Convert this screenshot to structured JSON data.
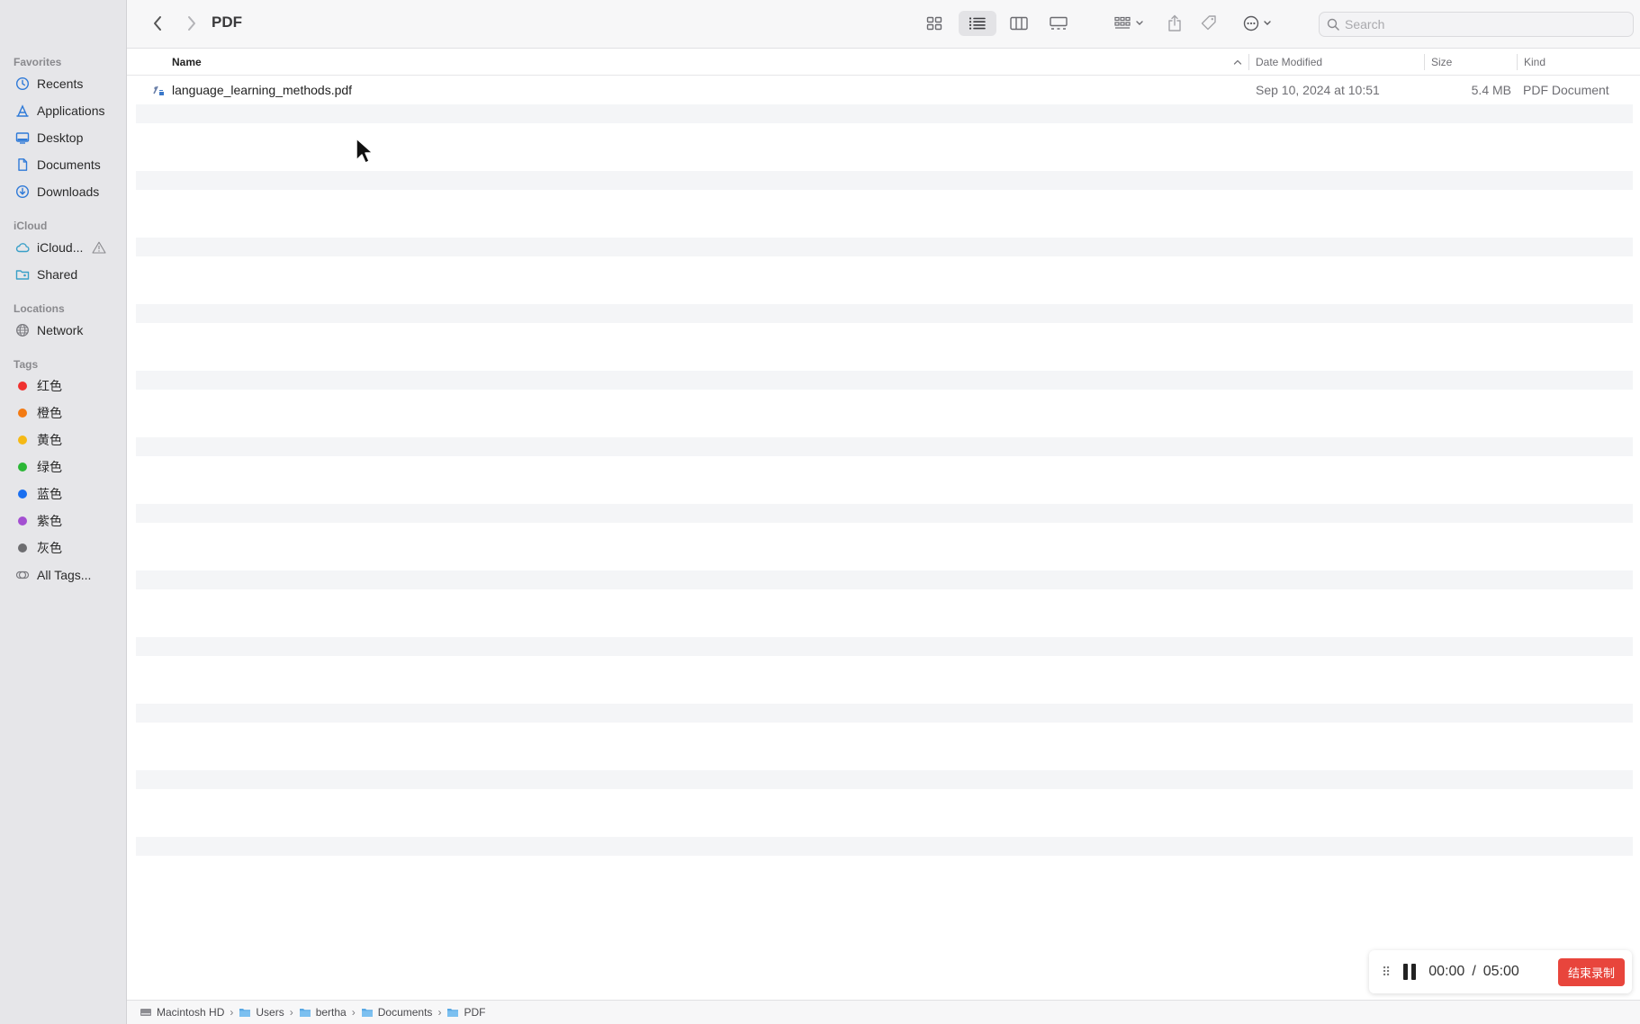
{
  "window": {
    "title": "PDF"
  },
  "toolbar": {
    "search_placeholder": "Search",
    "accent": "#2f7ad8"
  },
  "sidebar": {
    "favorites_label": "Favorites",
    "favorites": [
      {
        "label": "Recents",
        "icon": "clock-icon"
      },
      {
        "label": "Applications",
        "icon": "applications-icon"
      },
      {
        "label": "Desktop",
        "icon": "desktop-icon"
      },
      {
        "label": "Documents",
        "icon": "document-icon"
      },
      {
        "label": "Downloads",
        "icon": "download-icon"
      }
    ],
    "icloud_label": "iCloud",
    "icloud": [
      {
        "label": "iCloud...",
        "icon": "cloud-icon"
      },
      {
        "label": "Shared",
        "icon": "shared-folder-icon"
      }
    ],
    "locations_label": "Locations",
    "locations": [
      {
        "label": "Network",
        "icon": "globe-icon"
      }
    ],
    "tags_label": "Tags",
    "tags": [
      {
        "label": "红色",
        "color": "#f0312f"
      },
      {
        "label": "橙色",
        "color": "#f37a12"
      },
      {
        "label": "黄色",
        "color": "#f5b915"
      },
      {
        "label": "绿色",
        "color": "#2bb736"
      },
      {
        "label": "蓝色",
        "color": "#1a6ff0"
      },
      {
        "label": "紫色",
        "color": "#a34fd1"
      },
      {
        "label": "灰色",
        "color": "#6d6d70"
      }
    ],
    "all_tags": "All Tags..."
  },
  "columns": {
    "name": "Name",
    "date_modified": "Date Modified",
    "size": "Size",
    "kind": "Kind"
  },
  "files": [
    {
      "name": "language_learning_methods.pdf",
      "date_modified": "Sep 10, 2024 at 10:51",
      "size": "5.4 MB",
      "kind": "PDF Document"
    }
  ],
  "pathbar": [
    "Macintosh HD",
    "Users",
    "bertha",
    "Documents",
    "PDF"
  ],
  "recorder": {
    "elapsed": "00:00",
    "separator": "/",
    "total": "05:00",
    "stop_label": "结束录制",
    "stop_color": "#e8453c"
  }
}
